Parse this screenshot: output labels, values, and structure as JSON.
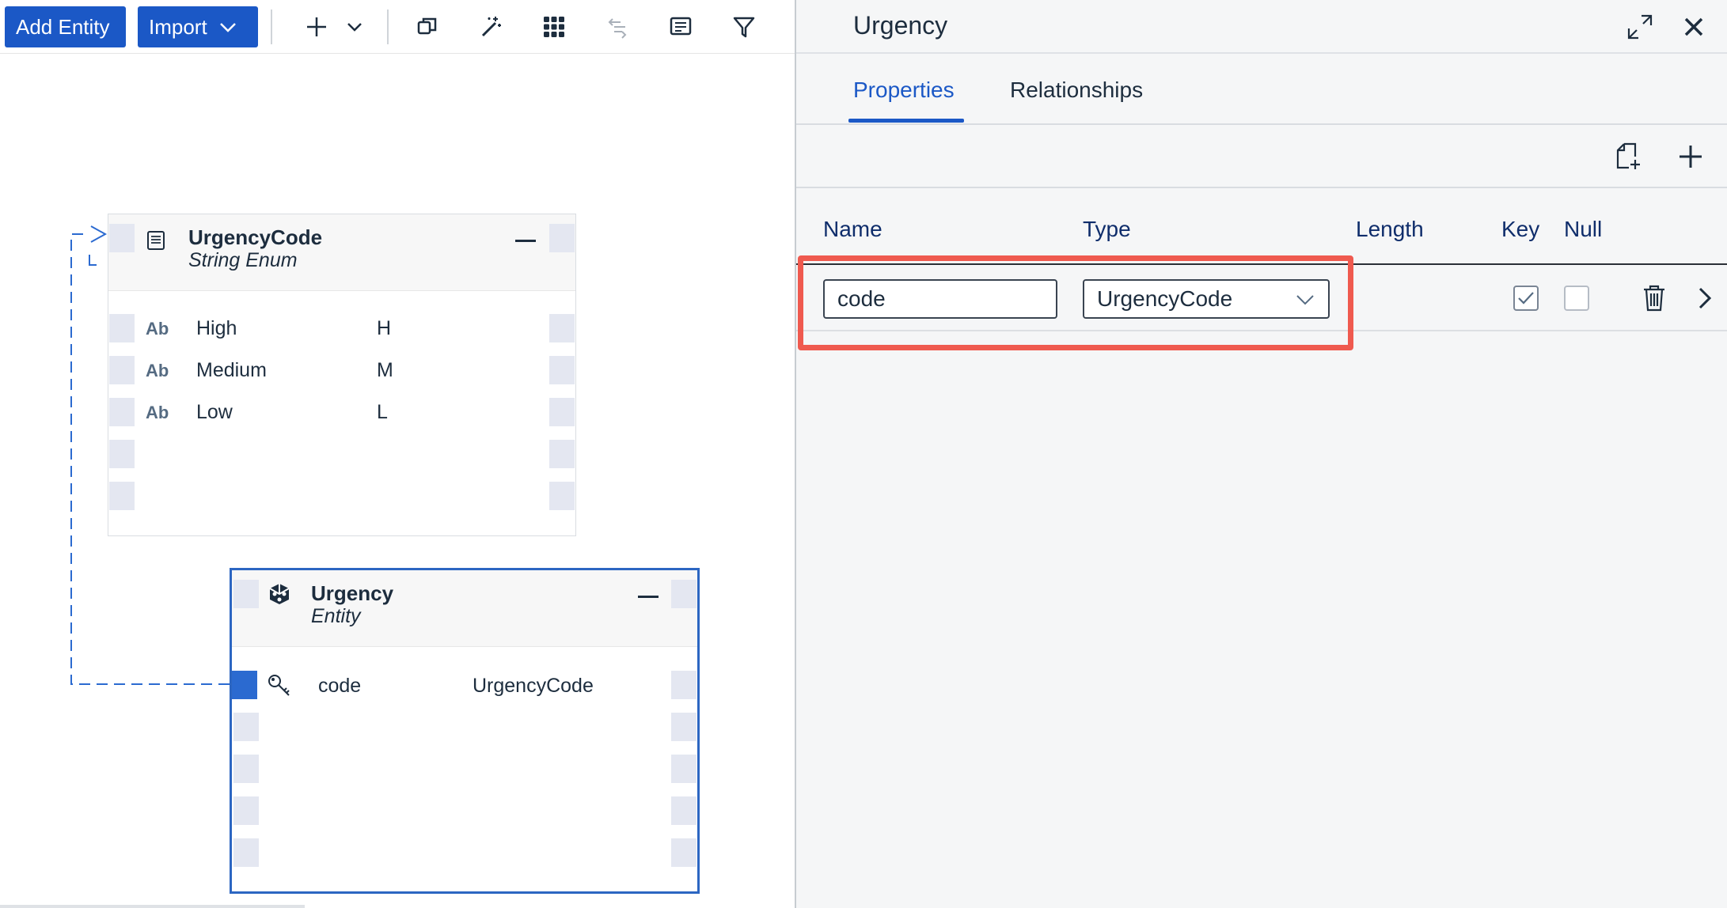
{
  "toolbar": {
    "add_entity": "Add Entity",
    "import": "Import",
    "icons": [
      "plus-icon",
      "chevron-down-icon",
      "copy-icon",
      "magic-wand-icon",
      "grid-icon",
      "flow-icon",
      "comment-icon",
      "filter-icon"
    ]
  },
  "canvas": {
    "enum_node": {
      "title": "UrgencyCode",
      "subtitle": "String Enum",
      "rows": [
        {
          "type": "Ab",
          "name": "High",
          "value": "H"
        },
        {
          "type": "Ab",
          "name": "Medium",
          "value": "M"
        },
        {
          "type": "Ab",
          "name": "Low",
          "value": "L"
        }
      ]
    },
    "entity_node": {
      "title": "Urgency",
      "subtitle": "Entity",
      "rows": [
        {
          "name": "code",
          "type": "UrgencyCode"
        }
      ]
    }
  },
  "panel": {
    "title": "Urgency",
    "tabs": [
      "Properties",
      "Relationships"
    ],
    "active_tab": "Properties",
    "columns": [
      "Name",
      "Type",
      "Length",
      "Key",
      "Null"
    ],
    "row": {
      "name": "code",
      "type": "UrgencyCode",
      "key": true,
      "null": false
    }
  },
  "colors": {
    "accent": "#1b58c6",
    "highlight": "#ef5a4f"
  }
}
